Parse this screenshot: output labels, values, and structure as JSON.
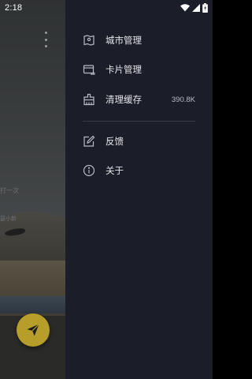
{
  "status_bar": {
    "time": "2:18",
    "icons": [
      "wifi-icon",
      "signal-icon",
      "battery-icon"
    ]
  },
  "background": {
    "text_line_1": "打一次",
    "text_line_2": "瑟小新",
    "fab_icon": "send-icon",
    "more_icon": "more-vertical-icon",
    "fab_color": "#b79d2a"
  },
  "drawer": {
    "background_color": "#1b1d28",
    "items": [
      {
        "label": "城市管理",
        "icon": "city-icon"
      },
      {
        "label": "卡片管理",
        "icon": "card-icon"
      },
      {
        "label": "清理缓存",
        "icon": "broom-icon",
        "value": "390.8K"
      },
      {
        "label": "反馈",
        "icon": "feedback-icon"
      },
      {
        "label": "关于",
        "icon": "info-icon"
      }
    ]
  }
}
